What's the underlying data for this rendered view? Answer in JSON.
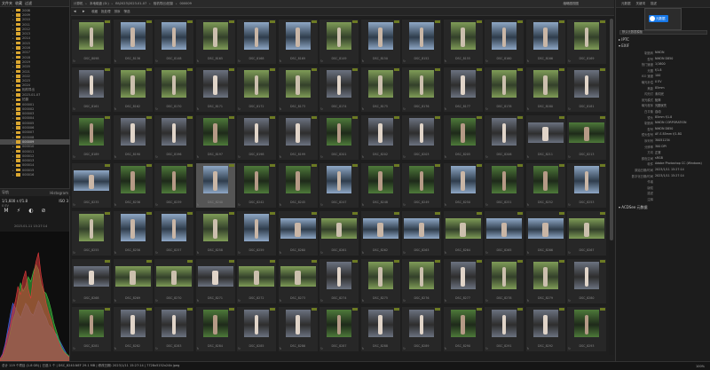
{
  "left_panel": {
    "tabs": [
      "文件夹",
      "收藏",
      "过滤"
    ],
    "folders": [
      {
        "label": "2008"
      },
      {
        "label": "2009"
      },
      {
        "label": "2010"
      },
      {
        "label": "2011"
      },
      {
        "label": "2012"
      },
      {
        "label": "2013"
      },
      {
        "label": "2014"
      },
      {
        "label": "2015"
      },
      {
        "label": "2016"
      },
      {
        "label": "2017"
      },
      {
        "label": "2018"
      },
      {
        "label": "2019"
      },
      {
        "label": "2020"
      },
      {
        "label": "2021"
      },
      {
        "label": "2022"
      },
      {
        "label": "2023"
      },
      {
        "label": "2024"
      },
      {
        "label": "相机导出"
      },
      {
        "label": "2023-01-07"
      },
      {
        "label": "拍摄"
      },
      {
        "label": "000001"
      },
      {
        "label": "000002"
      },
      {
        "label": "000003"
      },
      {
        "label": "000004"
      },
      {
        "label": "000005"
      },
      {
        "label": "000006"
      },
      {
        "label": "000007"
      },
      {
        "label": "000008"
      },
      {
        "label": "000009",
        "selected": true
      },
      {
        "label": "000010"
      },
      {
        "label": "000011"
      },
      {
        "label": "000012"
      },
      {
        "label": "000013"
      },
      {
        "label": "000014"
      },
      {
        "label": "000015"
      },
      {
        "label": "000016"
      }
    ],
    "nav": {
      "title": "导航",
      "mode": "Histogram",
      "exif_line": "1/1,600 s  f/1.8",
      "iso": "ISO 3",
      "exif_sub": "0 EV",
      "date": "2023-01-11 15:27:14"
    },
    "histogram": {
      "red": [
        0.02,
        0.05,
        0.12,
        0.22,
        0.3,
        0.42,
        0.5,
        0.62,
        0.55,
        0.68,
        0.75,
        0.6,
        0.52,
        0.7,
        0.82,
        0.9,
        0.72,
        0.6,
        0.48,
        0.4,
        0.34,
        0.26,
        0.2,
        0.15,
        0.1,
        0.07,
        0.05,
        0.03
      ],
      "green": [
        0.01,
        0.03,
        0.08,
        0.15,
        0.24,
        0.34,
        0.4,
        0.52,
        0.65,
        0.58,
        0.62,
        0.7,
        0.66,
        0.74,
        0.8,
        0.76,
        0.64,
        0.58,
        0.56,
        0.5,
        0.42,
        0.32,
        0.25,
        0.18,
        0.12,
        0.08,
        0.06,
        0.04
      ],
      "blue": [
        0.02,
        0.06,
        0.14,
        0.26,
        0.38,
        0.48,
        0.44,
        0.4,
        0.36,
        0.42,
        0.48,
        0.45,
        0.4,
        0.38,
        0.44,
        0.5,
        0.46,
        0.4,
        0.36,
        0.3,
        0.28,
        0.25,
        0.22,
        0.18,
        0.14,
        0.1,
        0.06,
        0.04
      ]
    }
  },
  "topbar": {
    "crumbs": [
      "计算机",
      "本地磁盘 (D:)",
      "Bi\\2023\\2023-01-07",
      "相机导出\\拍摄",
      "000009"
    ],
    "view_label": "缩略图视图"
  },
  "toolbar": {
    "items": [
      "收藏",
      "批处理",
      "排序",
      "筛选"
    ]
  },
  "grid": {
    "files": [
      "DSC_8098",
      "DSC_8136",
      "DSC_8148",
      "DSC_8165",
      "DSC_8168",
      "DSC_8169",
      "DSC_8149",
      "DSC_8150",
      "DSC_8152",
      "DSC_8155",
      "DSC_8160",
      "DSC_8166",
      "DSC_8169",
      "DSC_8161",
      "DSC_8162",
      "DSC_8170",
      "DSC_8171",
      "DSC_8172",
      "DSC_8173",
      "DSC_8174",
      "DSC_8175",
      "DSC_8176",
      "DSC_8177",
      "DSC_8178",
      "DSC_8180",
      "DSC_8181",
      "DSC_8189",
      "DSC_8190",
      "DSC_8196",
      "DSC_8197",
      "DSC_8198",
      "DSC_8199",
      "DSC_8201",
      "DSC_8202",
      "DSC_8203",
      "DSC_8205",
      "DSC_8206",
      "DSC_8211",
      "DSC_8213",
      "DSC_8235",
      "DSC_8236",
      "DSC_8239",
      "DSC_8240",
      "DSC_8242",
      "DSC_8245",
      "DSC_8247",
      "DSC_8248",
      "DSC_8249",
      "DSC_8250",
      "DSC_8251",
      "DSC_8252",
      "DSC_8253",
      "DSC_8255",
      "DSC_8256",
      "DSC_8257",
      "DSC_8258",
      "DSC_8259",
      "DSC_8260",
      "DSC_8261",
      "DSC_8262",
      "DSC_8263",
      "DSC_8264",
      "DSC_8265",
      "DSC_8266",
      "DSC_8267",
      "DSC_8268",
      "DSC_8269",
      "DSC_8270",
      "DSC_8271",
      "DSC_8272",
      "DSC_8273",
      "DSC_8274",
      "DSC_8275",
      "DSC_8276",
      "DSC_8277",
      "DSC_8278",
      "DSC_8279",
      "DSC_8280",
      "DSC_8281",
      "DSC_8282",
      "DSC_8283",
      "DSC_8284",
      "DSC_8285",
      "DSC_8286",
      "DSC_8287",
      "DSC_8288",
      "DSC_8289",
      "DSC_8290",
      "DSC_8291",
      "DSC_8292",
      "DSC_8293"
    ]
  },
  "right_panel": {
    "tabs": [
      "元数据",
      "关键词",
      "描述"
    ],
    "popup_label": "元数据",
    "select_value": "默认元数据模板",
    "iptc_label": "IPTC",
    "exif_label": "EXIF",
    "acdsee_label": "ACDSee 元数据",
    "rows": [
      {
        "k": "制造商",
        "v": "NIKON"
      },
      {
        "k": "型号",
        "v": "NIKON D850"
      },
      {
        "k": "快门速度",
        "v": "1/1600"
      },
      {
        "k": "光圈",
        "v": "f/1.8"
      },
      {
        "k": "ISO 速度",
        "v": "100"
      },
      {
        "k": "曝光补偿",
        "v": "0 EV"
      },
      {
        "k": "焦距",
        "v": "85mm"
      },
      {
        "k": "闪光灯",
        "v": "未闪光"
      },
      {
        "k": "测光模式",
        "v": "矩阵"
      },
      {
        "k": "曝光程序",
        "v": "光圈优先"
      },
      {
        "k": "白平衡",
        "v": "自动"
      },
      {
        "k": "镜头",
        "v": "85mm f/1.8"
      },
      {
        "k": "制造商",
        "v": "NIKON CORPORATION"
      },
      {
        "k": "型号",
        "v": "NIKON D850"
      },
      {
        "k": "镜头型号",
        "v": "AF-S 85mm f/1.8G"
      },
      {
        "k": "序列号",
        "v": "30051234"
      },
      {
        "k": "分辨率",
        "v": "300 DPI"
      },
      {
        "k": "方向",
        "v": "正常"
      },
      {
        "k": "颜色空间",
        "v": "sRGB"
      },
      {
        "k": "软件",
        "v": "Adobe Photoshop CC (Windows)"
      },
      {
        "k": "原始日期/时间",
        "v": "2023/1/11 15:27:14"
      },
      {
        "k": "数字化日期/时间",
        "v": "2023/1/11 15:27:14"
      },
      {
        "k": "作者",
        "v": ""
      },
      {
        "k": "版权",
        "v": ""
      },
      {
        "k": "描述",
        "v": ""
      },
      {
        "k": "注释",
        "v": ""
      }
    ]
  },
  "statusbar": {
    "left": "总计 119 个项目 (1.8 GB)  |  已选 1 个  |  DSC_8240.NEF  29.1 MB  |  修改日期: 2023/1/11 15:27:14  |  7728x5152x24b jpeg",
    "right": "100%"
  }
}
